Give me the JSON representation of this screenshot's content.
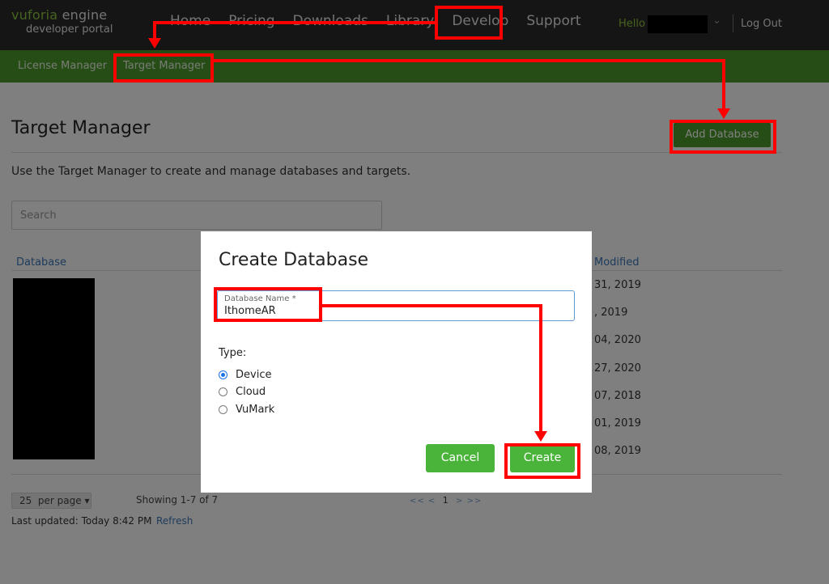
{
  "nav": {
    "logo_line1_brand": "vuforia",
    "logo_line1_rest": "engine",
    "logo_line2": "developer portal",
    "links": [
      "Home",
      "Pricing",
      "Downloads",
      "Library",
      "Develop",
      "Support"
    ],
    "hello": "Hello",
    "logout": "Log Out"
  },
  "subnav": {
    "license_manager": "License Manager",
    "target_manager": "Target Manager"
  },
  "page": {
    "title": "Target Manager",
    "add_database": "Add Database",
    "description": "Use the Target Manager to create and manage databases and targets.",
    "search_placeholder": "Search",
    "col_database": "Database",
    "col_modified": "Modified",
    "dates": [
      "31, 2019",
      ", 2019",
      "04, 2020",
      "27, 2020",
      "07, 2018",
      "01, 2019",
      "08, 2019"
    ]
  },
  "footer": {
    "per_page": "25  per page",
    "showing": "Showing 1-7 of 7",
    "pager_prev": "<< <",
    "current_page": "1",
    "pager_next": "> >>",
    "last_updated": "Last updated: Today 8:42 PM",
    "refresh": "Refresh"
  },
  "modal": {
    "title": "Create Database",
    "field_label": "Database Name *",
    "field_value": "IthomeAR",
    "type_label": "Type:",
    "options": [
      {
        "label": "Device",
        "checked": true
      },
      {
        "label": "Cloud",
        "checked": false
      },
      {
        "label": "VuMark",
        "checked": false
      }
    ],
    "cancel": "Cancel",
    "create": "Create"
  },
  "colors": {
    "brand_green": "#4c9a2a",
    "button_green": "#4ab43a",
    "annotation_red": "#ff0000",
    "nav_dark": "#2b2b2b"
  }
}
